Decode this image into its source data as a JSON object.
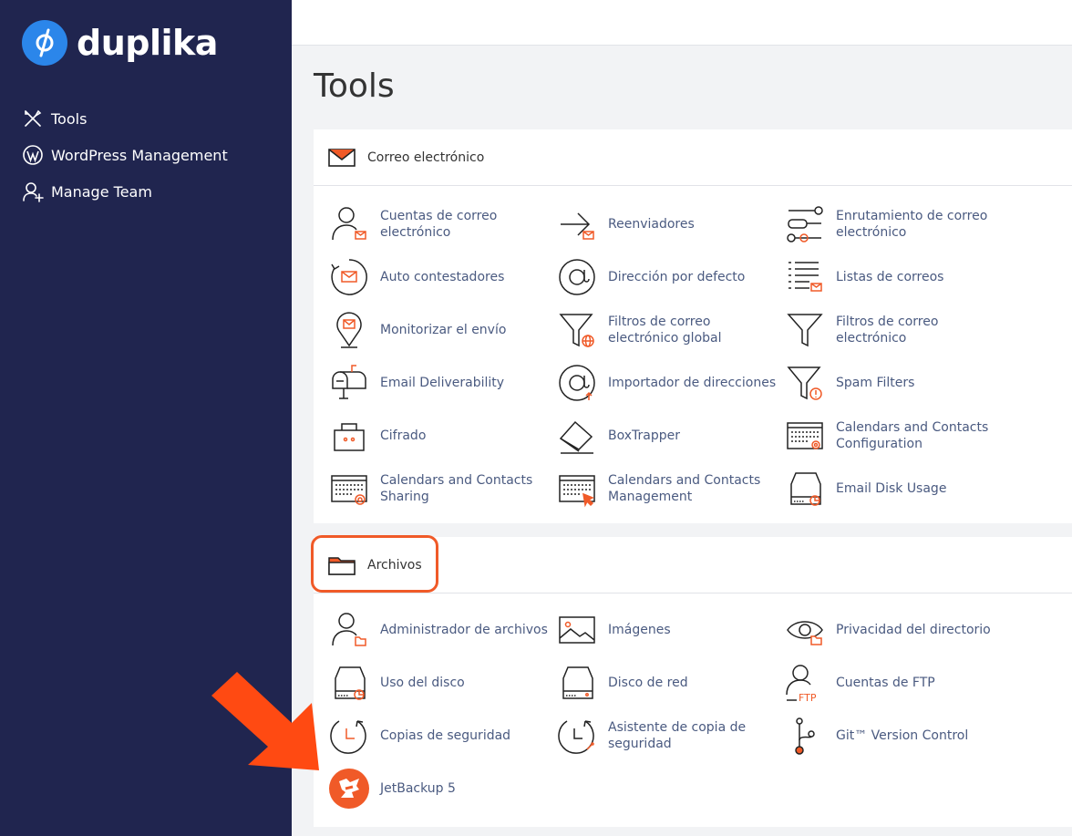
{
  "brand": {
    "name": "duplika",
    "accent": "#2b86ea",
    "sidebar_bg": "#20254f",
    "orange": "#f05a28"
  },
  "sidebar": {
    "items": [
      {
        "label": "Tools",
        "icon": "tools-icon"
      },
      {
        "label": "WordPress Management",
        "icon": "wordpress-icon"
      },
      {
        "label": "Manage Team",
        "icon": "add-user-icon"
      }
    ]
  },
  "page": {
    "title": "Tools"
  },
  "sections": {
    "email": {
      "title": "Correo electrónico",
      "items": [
        "Cuentas de correo electrónico",
        "Reenviadores",
        "Enrutamiento de correo electrónico",
        "Auto contestadores",
        "Dirección por defecto",
        "Listas de correos",
        "Monitorizar el envío",
        "Filtros de correo electrónico global",
        "Filtros de correo electrónico",
        "Email Deliverability",
        "Importador de direcciones",
        "Spam Filters",
        "Cifrado",
        "BoxTrapper",
        "Calendars and Contacts Configuration",
        "Calendars and Contacts Sharing",
        "Calendars and Contacts Management",
        "Email Disk Usage"
      ]
    },
    "files": {
      "title": "Archivos",
      "items": [
        "Administrador de archivos",
        "Imágenes",
        "Privacidad del directorio",
        "Uso del disco",
        "Disco de red",
        "Cuentas de FTP",
        "Copias de seguridad",
        "Asistente de copia de seguridad",
        "Git™ Version Control",
        "JetBackup 5"
      ]
    }
  },
  "icons": {
    "ftp_text": "FTP"
  }
}
